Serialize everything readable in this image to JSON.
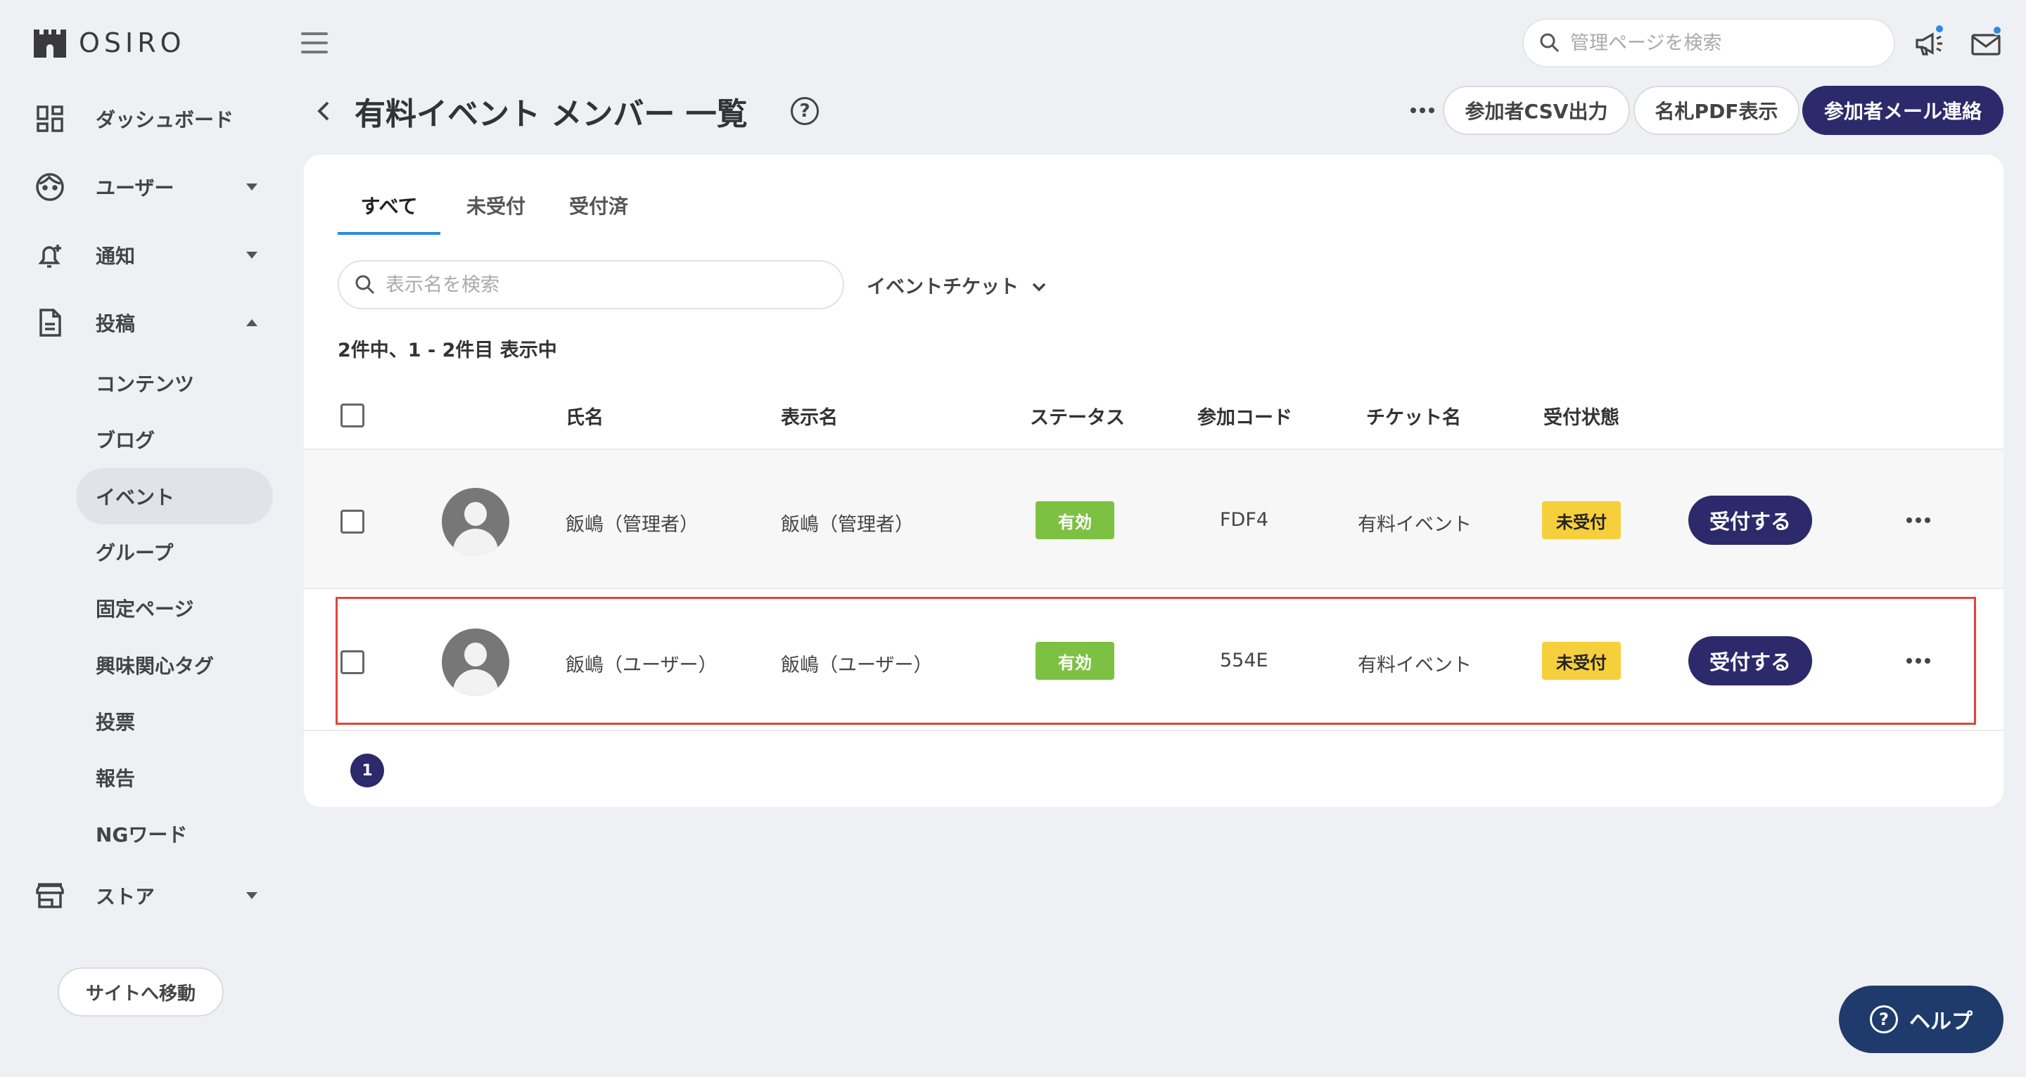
{
  "brand": {
    "name": "OSIRO"
  },
  "sidebar": {
    "items": [
      {
        "label": "ダッシュボード"
      },
      {
        "label": "ユーザー"
      },
      {
        "label": "通知"
      },
      {
        "label": "投稿"
      },
      {
        "label": "ストア"
      }
    ],
    "post_subitems": [
      {
        "label": "コンテンツ"
      },
      {
        "label": "ブログ"
      },
      {
        "label": "イベント"
      },
      {
        "label": "グループ"
      },
      {
        "label": "固定ページ"
      },
      {
        "label": "興味関心タグ"
      },
      {
        "label": "投票"
      },
      {
        "label": "報告"
      },
      {
        "label": "NGワード"
      }
    ],
    "active_subitem": "イベント",
    "site_button": "サイトへ移動"
  },
  "topbar": {
    "search_placeholder": "管理ページを検索"
  },
  "header": {
    "title": "有料イベント メンバー 一覧",
    "help_symbol": "?",
    "csv_button": "参加者CSV出力",
    "pdf_button": "名札PDF表示",
    "mail_button": "参加者メール連絡"
  },
  "tabs": [
    {
      "label": "すべて",
      "active": true
    },
    {
      "label": "未受付",
      "active": false
    },
    {
      "label": "受付済",
      "active": false
    }
  ],
  "filters": {
    "search_placeholder": "表示名を検索",
    "ticket_dropdown": "イベントチケット"
  },
  "result_count": "2件中、1 - 2件目 表示中",
  "table": {
    "columns": [
      "氏名",
      "表示名",
      "ステータス",
      "参加コード",
      "チケット名",
      "受付状態"
    ],
    "rows": [
      {
        "name": "飯嶋（管理者）",
        "display_name": "飯嶋（管理者）",
        "status": "有効",
        "code": "FDF4",
        "ticket": "有料イベント",
        "reception": "未受付",
        "action": "受付する"
      },
      {
        "name": "飯嶋（ユーザー）",
        "display_name": "飯嶋（ユーザー）",
        "status": "有効",
        "code": "554E",
        "ticket": "有料イベント",
        "reception": "未受付",
        "action": "受付する"
      }
    ]
  },
  "pagination": {
    "current": "1"
  },
  "help_button": {
    "label": "ヘルプ",
    "symbol": "?"
  },
  "colors": {
    "primary": "#2c2a6b",
    "status_active": "#7dc142",
    "reception_pending": "#f6cf3c",
    "tab_underline": "#2e8bdc",
    "highlight_outline": "#e0463a",
    "help_button": "#1f3b6b"
  }
}
